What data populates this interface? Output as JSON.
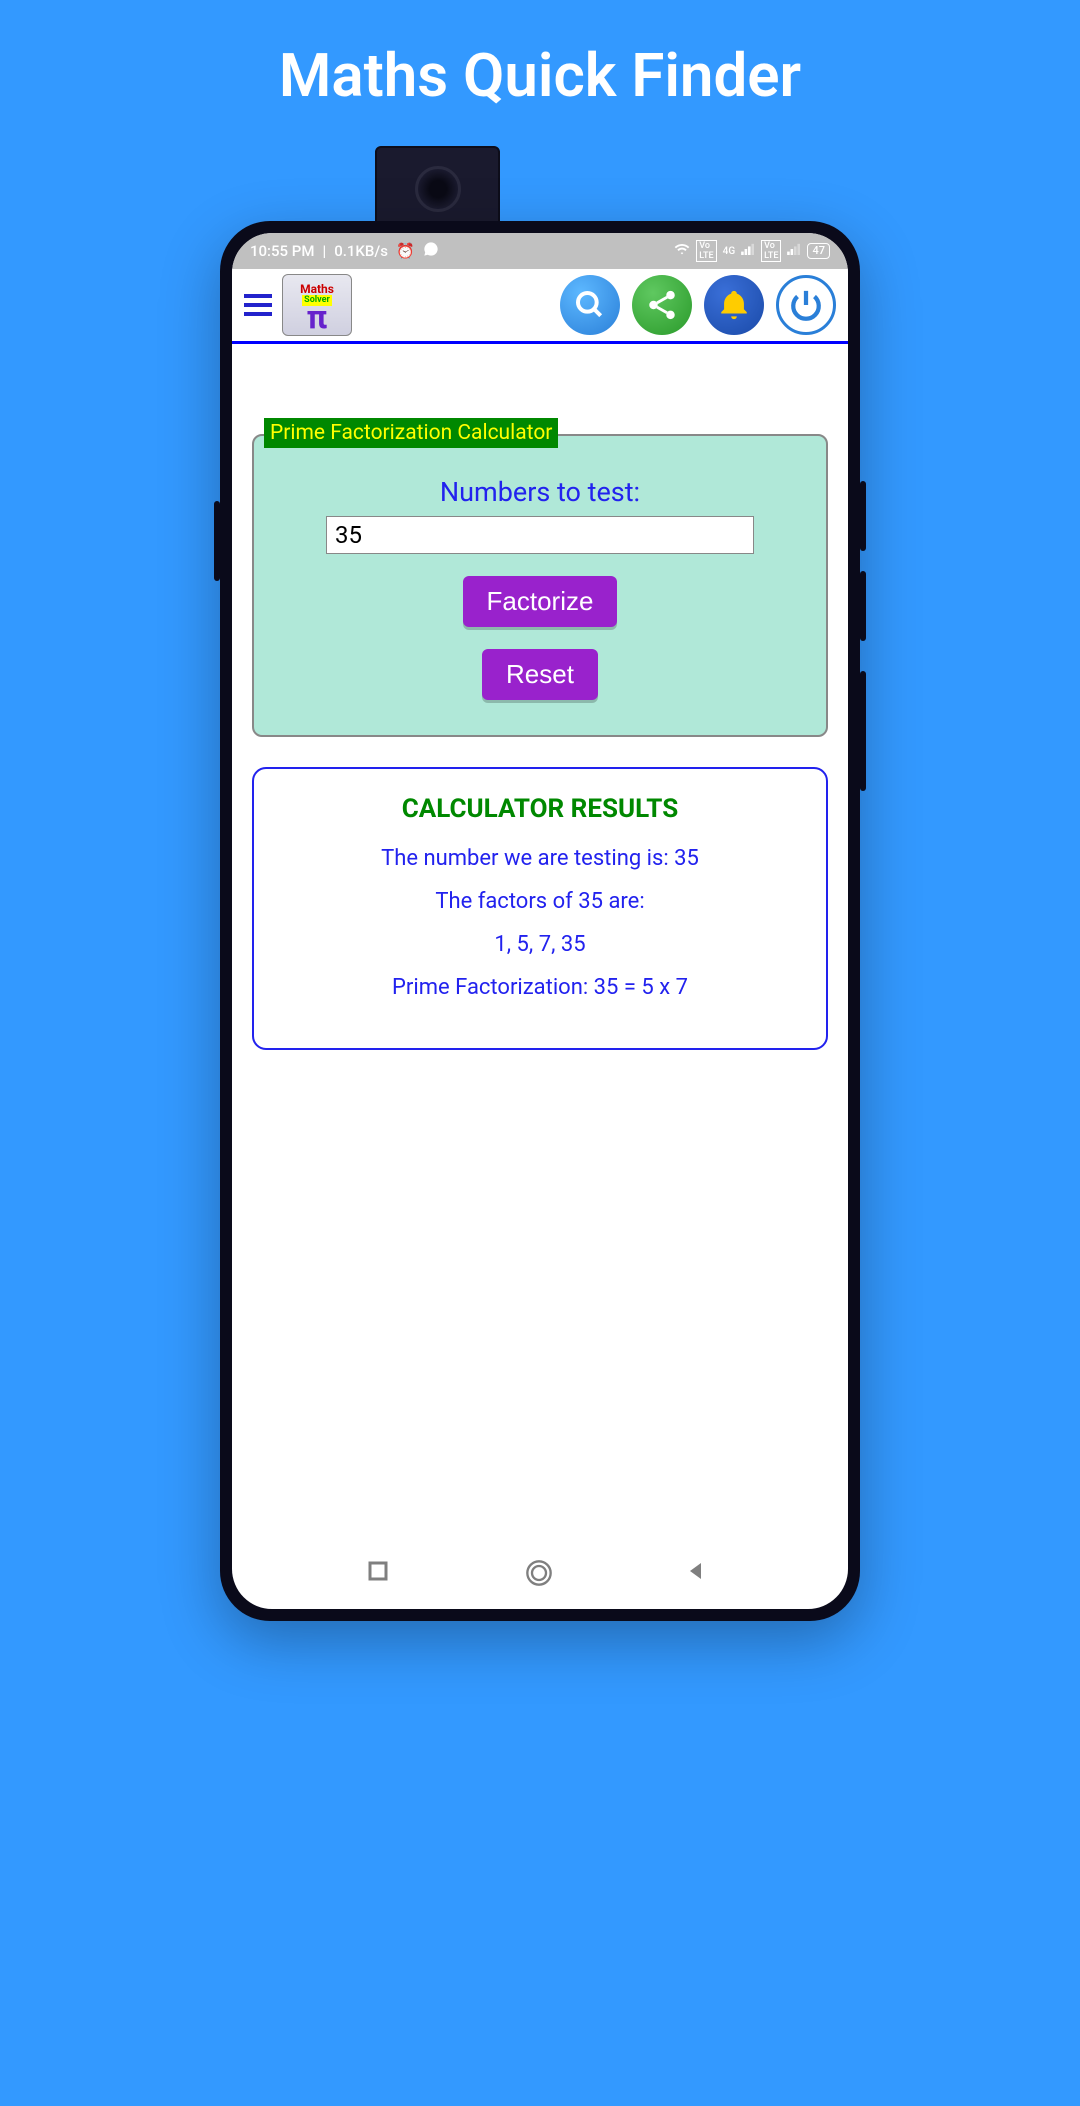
{
  "page_title": "Maths Quick Finder",
  "status": {
    "time": "10:55 PM",
    "speed": "0.1KB/s",
    "battery": "47",
    "network": "4G"
  },
  "logo": {
    "line1": "Maths",
    "line2": "Solver",
    "pi": "π"
  },
  "calculator": {
    "title": "Prime Factorization Calculator",
    "input_label": "Numbers to test:",
    "input_value": "35",
    "factorize_btn": "Factorize",
    "reset_btn": "Reset"
  },
  "results": {
    "heading": "CALCULATOR RESULTS",
    "testing": "The number we are testing is: 35",
    "factors_label": "The factors of 35 are:",
    "factors": "1, 5, 7, 35",
    "prime": "Prime Factorization: 35 = 5 x 7"
  },
  "icons": {
    "clock": "⏲",
    "whatsapp": "⌖",
    "wifi": "📶"
  }
}
